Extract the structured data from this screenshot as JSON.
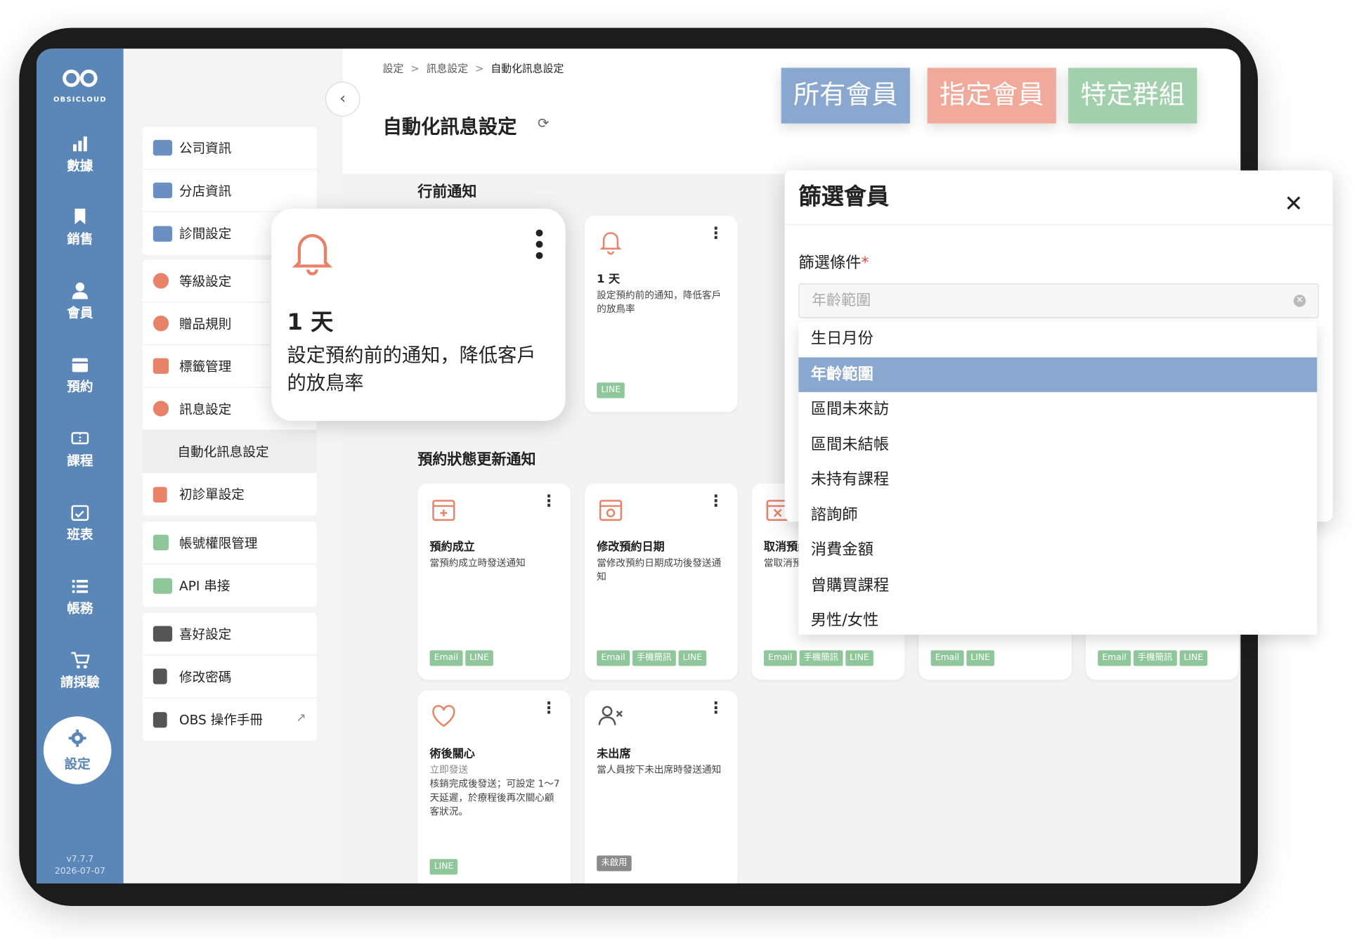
{
  "brand": {
    "name": "OBSICLOUD"
  },
  "rail": {
    "items": [
      {
        "label": "數據",
        "icon": "bar-chart-icon"
      },
      {
        "label": "銷售",
        "icon": "bookmark-icon"
      },
      {
        "label": "會員",
        "icon": "user-icon"
      },
      {
        "label": "預約",
        "icon": "calendar-icon"
      },
      {
        "label": "課程",
        "icon": "ticket-icon"
      },
      {
        "label": "班表",
        "icon": "schedule-icon"
      },
      {
        "label": "帳務",
        "icon": "list-icon"
      },
      {
        "label": "請採驗",
        "icon": "cart-icon"
      }
    ],
    "active": {
      "label": "設定",
      "icon": "gear-icon"
    },
    "version": "v7.7.7",
    "date": "2026-07-07"
  },
  "menu": {
    "group1": [
      "公司資訊",
      "分店資訊",
      "診間設定"
    ],
    "group2": [
      "等級設定",
      "贈品規則",
      "標籤管理",
      "訊息設定",
      "自動化訊息設定",
      "初診單設定"
    ],
    "group3": [
      "帳號權限管理",
      "API 串接"
    ],
    "group4": [
      "喜好設定",
      "修改密碼",
      "OBS 操作手冊"
    ]
  },
  "breadcrumb": [
    "設定",
    "訊息設定",
    "自動化訊息設定"
  ],
  "page_title": "自動化訊息設定",
  "sections": {
    "pre": "行前通知",
    "status": "預約狀態更新通知"
  },
  "popout": {
    "title": "1 天",
    "desc": "設定預約前的通知，降低客戶的放鳥率"
  },
  "pre_card": {
    "title": "1 天",
    "desc": "設定預約前的通知，降低客戶的放鳥率",
    "tags": [
      "LINE"
    ]
  },
  "status_cards": [
    {
      "title": "預約成立",
      "desc": "當預約成立時發送通知",
      "tags": [
        "Email",
        "LINE"
      ]
    },
    {
      "title": "修改預約日期",
      "desc": "當修改預約日期成功後發送通知",
      "tags": [
        "Email",
        "手機簡訊",
        "LINE"
      ]
    },
    {
      "title": "取消預約",
      "desc": "當取消預約",
      "tags": [
        "Email",
        "手機簡訊",
        "LINE"
      ]
    },
    {
      "tags": [
        "Email",
        "LINE"
      ]
    },
    {
      "tags": [
        "Email",
        "手機簡訊",
        "LINE"
      ]
    }
  ],
  "row3_cards": [
    {
      "title": "術後關心",
      "sub": "立即發送",
      "desc": "核銷完成後發送；可設定 1～7 天延遲，於療程後再次關心顧客狀況。",
      "tags": [
        "LINE"
      ]
    },
    {
      "title": "未出席",
      "desc": "當人員按下未出席時發送通知",
      "tags": [
        "未啟用"
      ]
    }
  ],
  "member_types": [
    {
      "label": "所有會員",
      "color": "#8aa8cf"
    },
    {
      "label": "指定會員",
      "color": "#f0a99a"
    },
    {
      "label": "特定群組",
      "color": "#a3d0ac"
    }
  ],
  "modal": {
    "title": "篩選會員",
    "field_label": "篩選條件",
    "required_mark": "*",
    "selected": "年齡範圍",
    "options": [
      "生日月份",
      "年齡範圍",
      "區間未來訪",
      "區間未結帳",
      "未持有課程",
      "諮詢師",
      "消費金額",
      "曾購買課程",
      "男性/女性"
    ],
    "active_option": "年齡範圍"
  },
  "colors": {
    "rail": "#5b86b8",
    "accent": "#e8836a",
    "tag": "#8fc79b"
  }
}
